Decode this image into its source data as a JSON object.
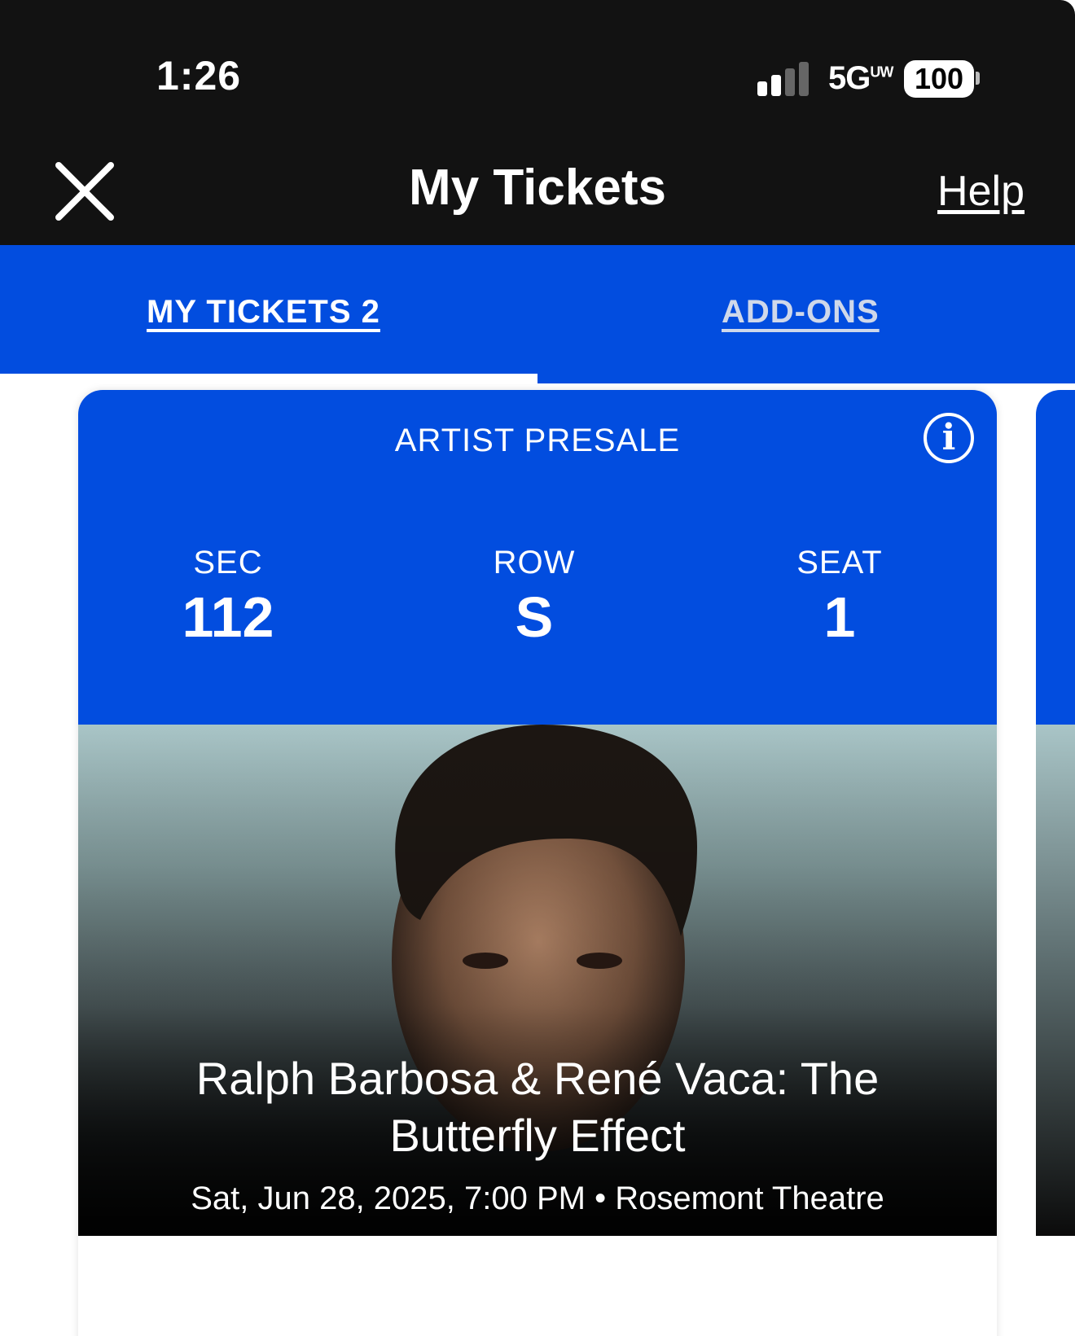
{
  "status_bar": {
    "time": "1:26",
    "network": "5G",
    "network_suffix": "UW",
    "battery": "100"
  },
  "header": {
    "title": "My Tickets",
    "help_label": "Help",
    "close_icon": "close-icon"
  },
  "tabs": [
    {
      "label": "MY TICKETS 2",
      "active": true
    },
    {
      "label": "ADD-ONS",
      "active": false
    }
  ],
  "ticket": {
    "presale_label": "ARTIST PRESALE",
    "info_icon": "info-icon",
    "section_label": "SEC",
    "section_value": "112",
    "row_label": "ROW",
    "row_value": "S",
    "seat_label": "SEAT",
    "seat_value": "1",
    "event_title": "Ralph Barbosa & René Vaca: The Butterfly Effect",
    "event_meta": "Sat, Jun 28, 2025, 7:00 PM • Rosemont Theatre"
  },
  "colors": {
    "brand_blue": "#024ddf",
    "header_bg": "#121212"
  }
}
